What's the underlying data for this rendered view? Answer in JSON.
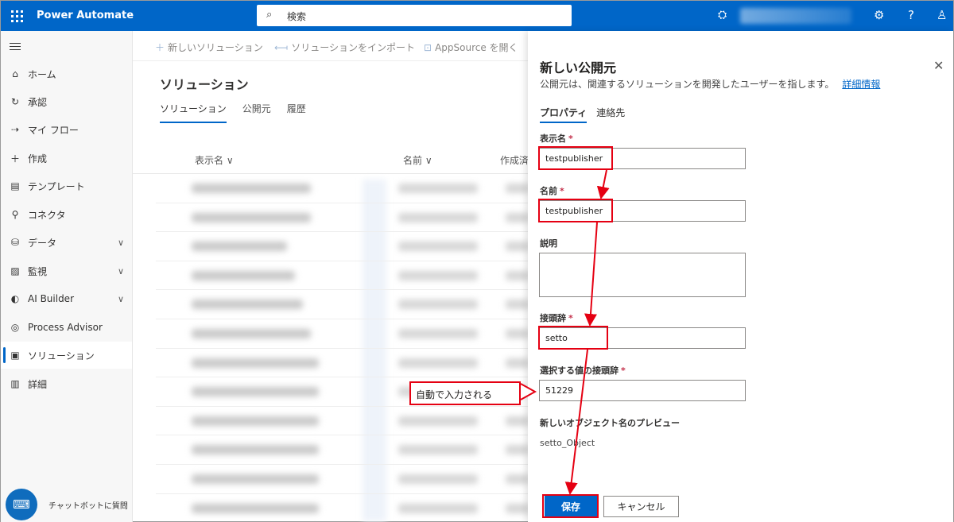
{
  "topbar": {
    "app_title": "Power Automate",
    "search_placeholder": "検索",
    "icons": [
      "waffle-icon",
      "search-icon",
      "environment-icon",
      "settings-icon",
      "help-icon",
      "user-icon"
    ],
    "help_label": "?"
  },
  "leftnav": {
    "items": [
      {
        "label": "ホーム",
        "icon": "home-icon"
      },
      {
        "label": "承認",
        "icon": "approvals-icon"
      },
      {
        "label": "マイ フロー",
        "icon": "flow-icon"
      },
      {
        "label": "作成",
        "icon": "plus-icon"
      },
      {
        "label": "テンプレート",
        "icon": "template-icon"
      },
      {
        "label": "コネクタ",
        "icon": "connector-icon"
      },
      {
        "label": "データ",
        "icon": "data-icon"
      },
      {
        "label": "監視",
        "icon": "monitor-icon"
      },
      {
        "label": "AI Builder",
        "icon": "ai-builder-icon"
      },
      {
        "label": "Process Advisor",
        "icon": "process-advisor-icon"
      },
      {
        "label": "ソリューション",
        "icon": "solutions-icon"
      },
      {
        "label": "詳細",
        "icon": "learn-icon"
      }
    ],
    "chatbot_label": "チャットボットに質問"
  },
  "commandbar": {
    "new_solution": "新しいソリューション",
    "import_solution": "ソリューションをインポート",
    "appsource": "AppSource を開く"
  },
  "main": {
    "title": "ソリューション",
    "tabs": [
      "ソリューション",
      "公開元",
      "履歴"
    ],
    "columns": [
      "表示名",
      "名前",
      "作成済"
    ]
  },
  "panel": {
    "title": "新しい公開元",
    "description": "公開元は、関連するソリューションを開発したユーザーを指します。",
    "learn_more": "詳細情報",
    "tabs": [
      "プロパティ",
      "連絡先"
    ],
    "fields": {
      "display_name": {
        "label": "表示名",
        "value": "testpublisher"
      },
      "name": {
        "label": "名前",
        "value": "testpublisher"
      },
      "description": {
        "label": "説明",
        "value": ""
      },
      "prefix": {
        "label": "接頭辞",
        "value": "setto"
      },
      "option_prefix": {
        "label": "選択する値の接頭辞",
        "value": "51229"
      }
    },
    "required_mark": "*",
    "preview_label": "新しいオブジェクト名のプレビュー",
    "preview_value": "setto_Object",
    "save": "保存",
    "cancel": "キャンセル"
  },
  "annotation": {
    "callout": "自動で入力される",
    "color": "#e50012"
  },
  "colors": {
    "brand": "#0066c8"
  }
}
